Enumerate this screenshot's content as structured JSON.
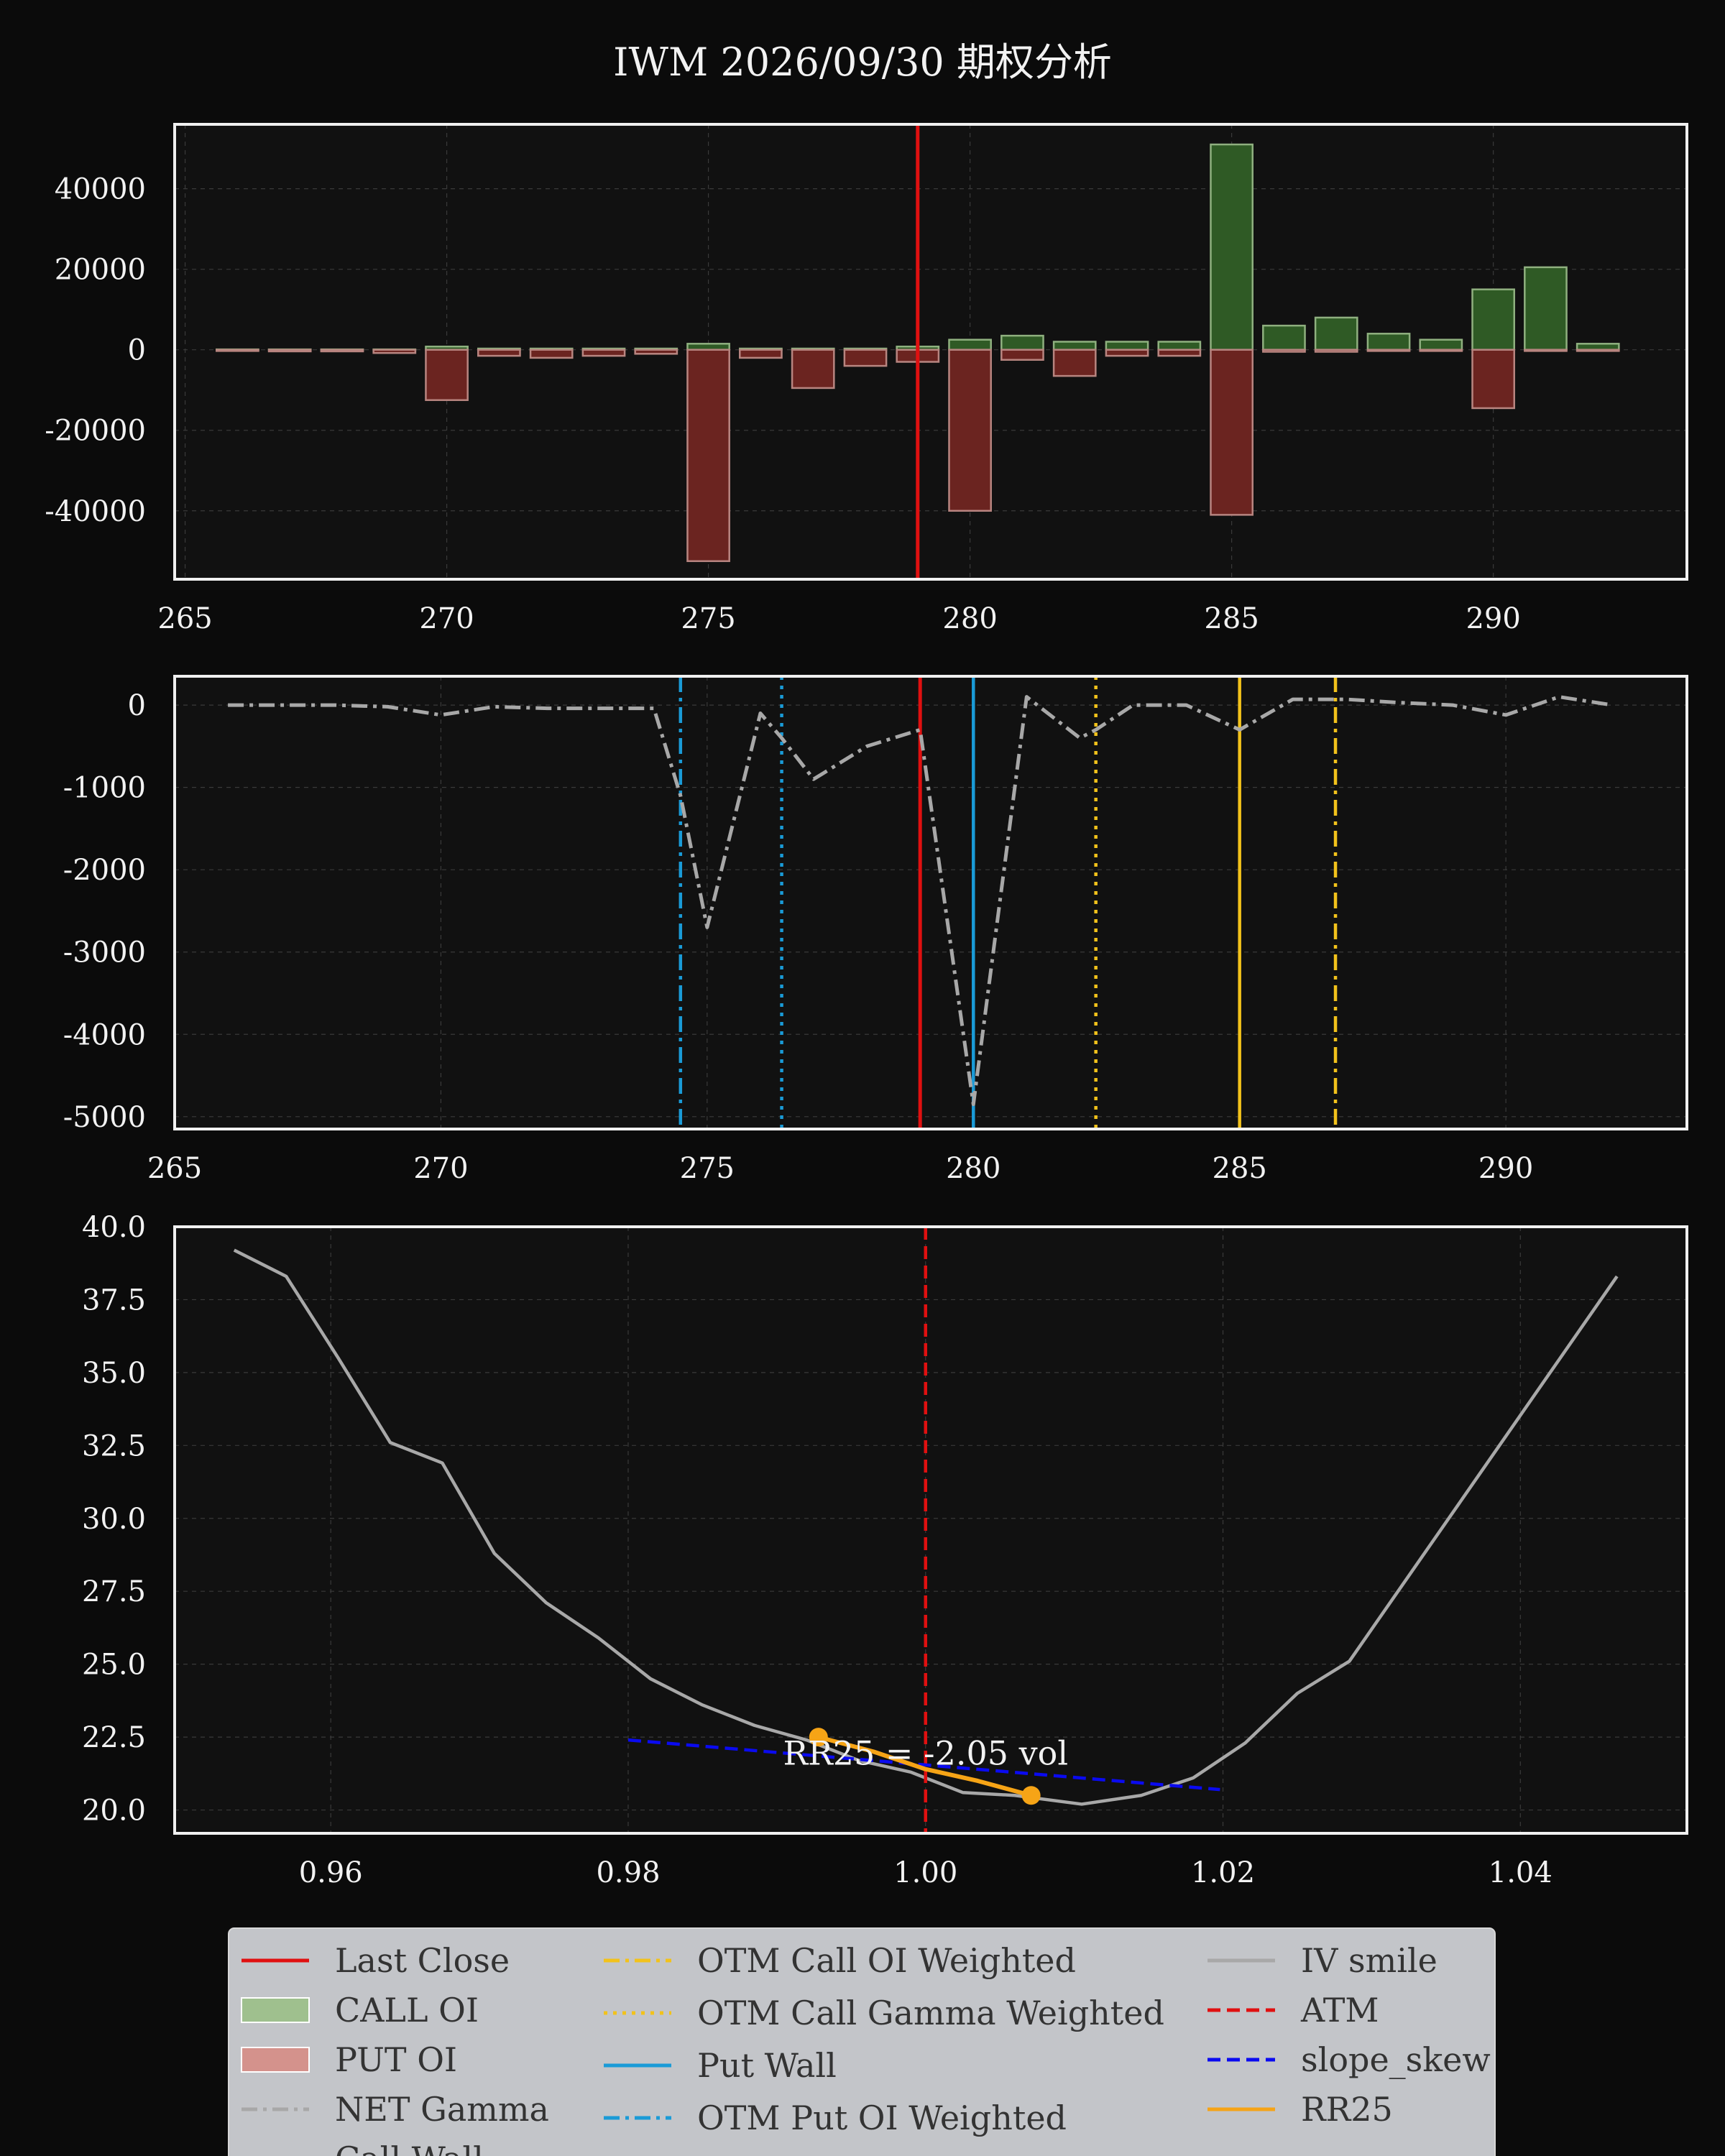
{
  "title": "IWM 2026/09/30 期权分析",
  "colors": {
    "background": "#0b0b0b",
    "axes_bg": "#111111",
    "last_close": "#e01010",
    "call": "#2f5a25",
    "put": "#6b2420",
    "net_gamma": "#a8a8a8",
    "wall": "#1a9bd7",
    "call_marker": "#f2c21b",
    "iv": "#a8a8a8",
    "slope": "#0a0af0",
    "rr25": "#f6a416"
  },
  "chart_data": [
    {
      "type": "bar",
      "name": "oi",
      "xlim": [
        264.8,
        293.7
      ],
      "ylim": [
        -57000,
        56000
      ],
      "x_ticks": [
        265,
        270,
        275,
        280,
        285,
        290
      ],
      "y_ticks": [
        40000,
        20000,
        0,
        -20000,
        -40000
      ],
      "x_tick_labels": [
        "265",
        "270",
        "275",
        "280",
        "285",
        "290"
      ],
      "y_tick_labels": [
        "40000",
        "20000",
        "0",
        "-20000",
        "-40000"
      ],
      "grid": true,
      "last_close": 279,
      "strikes": [
        266,
        267,
        268,
        269,
        270,
        271,
        272,
        273,
        274,
        275,
        276,
        277,
        278,
        279,
        280,
        281,
        282,
        283,
        284,
        285,
        286,
        287,
        288,
        289,
        290,
        291,
        292
      ],
      "series": [
        {
          "name": "CALL OI",
          "values": [
            100,
            100,
            100,
            100,
            800,
            300,
            300,
            300,
            300,
            1500,
            300,
            300,
            300,
            800,
            2500,
            3500,
            2000,
            2000,
            2000,
            51000,
            6000,
            8000,
            4000,
            2500,
            15000,
            20500,
            1500
          ]
        },
        {
          "name": "PUT OI",
          "values": [
            -300,
            -400,
            -400,
            -800,
            -12500,
            -1500,
            -2000,
            -1500,
            -1000,
            -52500,
            -2000,
            -9500,
            -4000,
            -3000,
            -40000,
            -2500,
            -6500,
            -1500,
            -1500,
            -41000,
            -500,
            -500,
            -300,
            -300,
            -14500,
            -300,
            -300
          ]
        }
      ]
    },
    {
      "type": "line",
      "name": "net_gamma",
      "xlim": [
        265,
        293.4
      ],
      "ylim": [
        -5150,
        350
      ],
      "x_ticks": [
        265,
        270,
        275,
        280,
        285,
        290
      ],
      "y_ticks": [
        0,
        -1000,
        -2000,
        -3000,
        -4000,
        -5000
      ],
      "x_tick_labels": [
        "265",
        "270",
        "275",
        "280",
        "285",
        "290"
      ],
      "y_tick_labels": [
        "0",
        "-1000",
        "-2000",
        "-3000",
        "-4000",
        "-5000"
      ],
      "grid": true,
      "series": [
        {
          "name": "NET Gamma",
          "x": [
            266,
            267,
            268,
            269,
            270,
            271,
            272,
            273,
            274,
            274.5,
            275,
            276,
            276.4,
            277,
            278,
            279,
            280,
            281,
            282,
            282.3,
            283,
            284,
            285,
            286,
            287,
            288,
            289,
            290,
            291,
            292
          ],
          "y": [
            0,
            0,
            0,
            -20,
            -120,
            -20,
            -40,
            -40,
            -40,
            -1100,
            -2700,
            -100,
            -400,
            -900,
            -500,
            -300,
            -4850,
            100,
            -400,
            -300,
            0,
            0,
            -300,
            70,
            70,
            30,
            0,
            -120,
            100,
            0
          ]
        }
      ],
      "markers": {
        "last_close": 279,
        "put_wall": 280,
        "otm_put_oi_weighted": 274.5,
        "otm_put_gamma_weighted": 276.4,
        "call_wall": 285,
        "otm_call_oi_weighted": 286.8,
        "otm_call_gamma_weighted": 282.3
      }
    },
    {
      "type": "line",
      "name": "iv_smile",
      "xlim": [
        0.9495,
        1.0512
      ],
      "ylim": [
        19.2,
        40
      ],
      "x_ticks": [
        0.96,
        0.98,
        1.0,
        1.02,
        1.04
      ],
      "y_ticks": [
        40.0,
        37.5,
        35.0,
        32.5,
        30.0,
        27.5,
        25.0,
        22.5,
        20.0
      ],
      "x_tick_labels": [
        "0.96",
        "0.98",
        "1.00",
        "1.02",
        "1.04"
      ],
      "y_tick_labels": [
        "40.0",
        "37.5",
        "35.0",
        "32.5",
        "30.0",
        "27.5",
        "25.0",
        "22.5",
        "20.0"
      ],
      "grid": true,
      "series": [
        {
          "name": "IV smile",
          "x": [
            0.9535,
            0.957,
            0.9605,
            0.964,
            0.9675,
            0.971,
            0.9745,
            0.978,
            0.9815,
            0.985,
            0.9885,
            0.992,
            0.9955,
            0.999,
            1.0025,
            1.006,
            1.0105,
            1.0145,
            1.018,
            1.0215,
            1.025,
            1.0285,
            1.0465
          ],
          "y": [
            39.2,
            38.3,
            35.5,
            32.6,
            31.9,
            28.8,
            27.1,
            25.9,
            24.5,
            23.6,
            22.9,
            22.4,
            21.7,
            21.3,
            20.6,
            20.5,
            20.2,
            20.5,
            21.1,
            22.3,
            24.0,
            25.1,
            38.3
          ]
        },
        {
          "name": "slope_skew",
          "x": [
            0.98,
            1.0198
          ],
          "y": [
            22.4,
            20.7
          ]
        },
        {
          "name": "RR25",
          "x": [
            0.9928,
            0.9965,
            1.0,
            1.0035,
            1.0071
          ],
          "y": [
            22.5,
            22.0,
            21.4,
            21.0,
            20.5
          ]
        }
      ],
      "atm": 1.0,
      "annotation": "RR25 = -2.05 vol"
    }
  ],
  "legend": [
    {
      "label": "Last Close",
      "style": "solid",
      "color": "#e01010"
    },
    {
      "label": "CALL OI",
      "style": "patch",
      "color": "#9fc08e"
    },
    {
      "label": "PUT OI",
      "style": "patch",
      "color": "#d4928c"
    },
    {
      "label": "NET Gamma",
      "style": "dashdot",
      "color": "#a8a8a8"
    },
    {
      "label": "Call Wall",
      "style": "solid",
      "color": "#f2c21b"
    },
    {
      "label": "OTM Call OI Weighted",
      "style": "dashdot",
      "color": "#f2c21b"
    },
    {
      "label": "OTM Call Gamma Weighted",
      "style": "dotted",
      "color": "#f2c21b"
    },
    {
      "label": "Put Wall",
      "style": "solid",
      "color": "#1a9bd7"
    },
    {
      "label": "OTM Put OI Weighted",
      "style": "dashdot",
      "color": "#1a9bd7"
    },
    {
      "label": "IV smile",
      "style": "solid",
      "color": "#a8a8a8"
    },
    {
      "label": "ATM",
      "style": "dashed",
      "color": "#e01010"
    },
    {
      "label": "slope_skew",
      "style": "dashed",
      "color": "#0a0af0"
    },
    {
      "label": "RR25",
      "style": "solid",
      "color": "#f6a416"
    }
  ]
}
